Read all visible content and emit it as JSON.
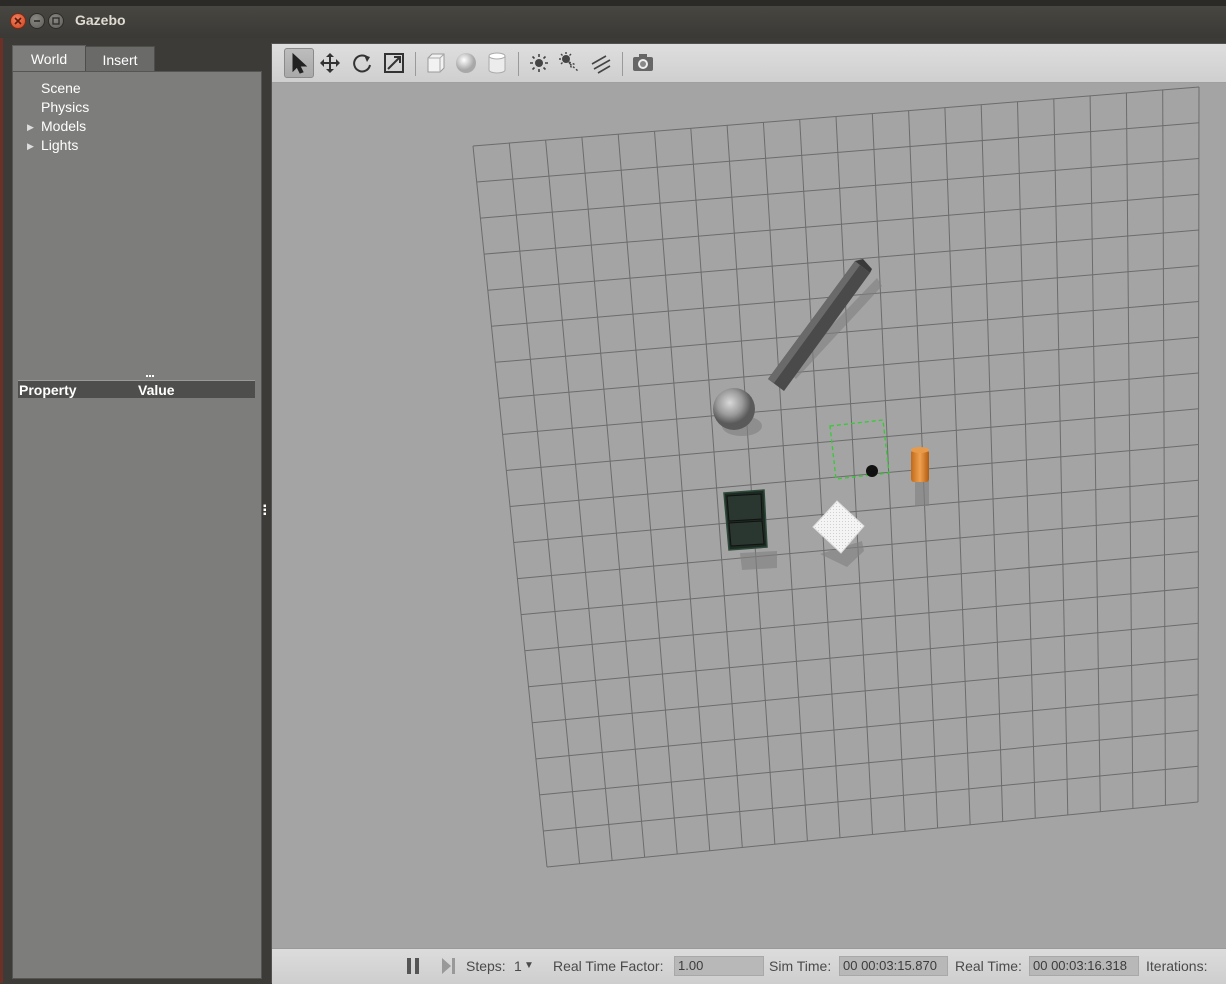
{
  "window": {
    "title": "Gazebo"
  },
  "tabs": {
    "world": "World",
    "insert": "Insert"
  },
  "tree": {
    "items": [
      {
        "label": "Scene",
        "expandable": false
      },
      {
        "label": "Physics",
        "expandable": false
      },
      {
        "label": "Models",
        "expandable": true
      },
      {
        "label": "Lights",
        "expandable": true
      }
    ]
  },
  "properties": {
    "col_property": "Property",
    "col_value": "Value"
  },
  "toolbar": {
    "tools": [
      "select-icon",
      "translate-icon",
      "rotate-icon",
      "scale-icon",
      "box-icon",
      "sphere-icon",
      "cylinder-icon",
      "point-light-icon",
      "spot-light-icon",
      "directional-light-icon",
      "screenshot-icon"
    ]
  },
  "status": {
    "steps_label": "Steps:",
    "steps_value": "1",
    "rtf_label": "Real Time Factor:",
    "rtf_value": "1.00",
    "sim_time_label": "Sim Time:",
    "sim_time_value": "00 00:03:15.870",
    "real_time_label": "Real Time:",
    "real_time_value": "00 00:03:16.318",
    "iterations_label": "Iterations:"
  },
  "colors": {
    "viewport_bg": "#a4a4a4",
    "grid": "#6c6c6c",
    "selection": "#33cc33",
    "cylinder": "#e08a2c"
  }
}
